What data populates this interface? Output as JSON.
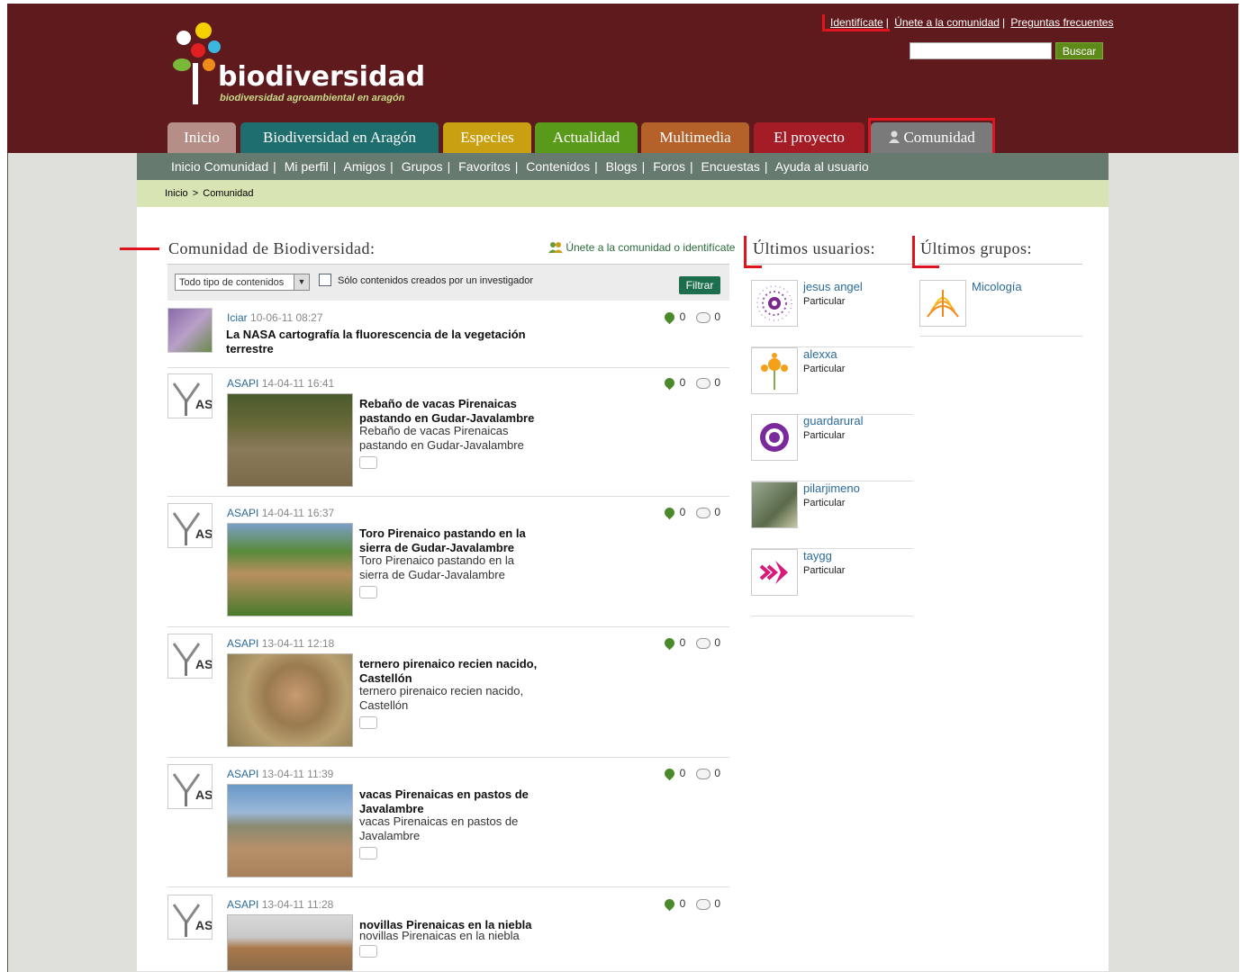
{
  "header": {
    "top_links": [
      "Identifícate",
      "Únete a la comunidad",
      "Preguntas frecuentes"
    ],
    "search_button": "Buscar",
    "logo_title": "biodiversidad",
    "logo_subtitle": "biodiversidad agroambiental en aragón"
  },
  "tabs": [
    "Inicio",
    "Biodiversidad en Aragón",
    "Especies",
    "Actualidad",
    "Multimedia",
    "El proyecto",
    "Comunidad"
  ],
  "tab_colors": [
    "#b58f87",
    "#1f6e6e",
    "#c9a011",
    "#5a9a1a",
    "#b5612a",
    "#a31c26",
    "#7a7a7a"
  ],
  "subnav": [
    "Inicio Comunidad",
    "Mi perfil",
    "Amigos",
    "Grupos",
    "Favoritos",
    "Contenidos",
    "Blogs",
    "Foros",
    "Encuestas",
    "Ayuda al usuario"
  ],
  "breadcrumb": {
    "home": "Inicio",
    "sep": ">",
    "current": "Comunidad"
  },
  "main": {
    "title": "Comunidad de Biodiversidad:",
    "join_text": "Únete a la comunidad o identifícate",
    "filter": {
      "select_value": "Todo tipo de contenidos",
      "checkbox_label": "Sólo contenidos creados por un investigador",
      "button": "Filtrar"
    },
    "feed": [
      {
        "author": "Iciar",
        "date": "10-06-11 08:27",
        "likes": "0",
        "comments": "0",
        "title": "La NASA cartografía la fluorescencia de la vegetación terrestre",
        "desc": ""
      },
      {
        "author": "ASAPI",
        "date": "14-04-11 16:41",
        "likes": "0",
        "comments": "0",
        "title": "Rebaño de vacas Pirenaicas pastando en Gudar-Javalambre",
        "desc": "Rebaño de vacas Pirenaicas pastando en Gudar-Javalambre"
      },
      {
        "author": "ASAPI",
        "date": "14-04-11 16:37",
        "likes": "0",
        "comments": "0",
        "title": "Toro Pirenaico pastando en la sierra de Gudar-Javalambre",
        "desc": "Toro Pirenaico pastando en la sierra de Gudar-Javalambre"
      },
      {
        "author": "ASAPI",
        "date": "13-04-11 12:18",
        "likes": "0",
        "comments": "0",
        "title": "ternero pirenaico recien nacido, Castellón",
        "desc": "ternero pirenaico recien nacido, Castellón"
      },
      {
        "author": "ASAPI",
        "date": "13-04-11 11:39",
        "likes": "0",
        "comments": "0",
        "title": "vacas Pirenaicas en pastos de Javalambre",
        "desc": "vacas Pirenaicas en pastos de Javalambre"
      },
      {
        "author": "ASAPI",
        "date": "13-04-11 11:28",
        "likes": "0",
        "comments": "0",
        "title": "novillas Pirenaicas en la niebla",
        "desc": "novillas Pirenaicas en la niebla"
      }
    ]
  },
  "users": {
    "title": "Últimos usuarios:",
    "items": [
      {
        "name": "jesus angel",
        "type": "Particular"
      },
      {
        "name": "alexxa",
        "type": "Particular"
      },
      {
        "name": "guardarural",
        "type": "Particular"
      },
      {
        "name": "pilarjimeno",
        "type": "Particular"
      },
      {
        "name": "taygg",
        "type": "Particular"
      }
    ]
  },
  "groups": {
    "title": "Últimos grupos:",
    "items": [
      {
        "name": "Micología"
      }
    ]
  },
  "colors": {
    "header": "#5e1a1d",
    "subnav": "#677a6f",
    "breadcrumb_bg": "#d9e4b4",
    "annotation": "#e0141e"
  }
}
